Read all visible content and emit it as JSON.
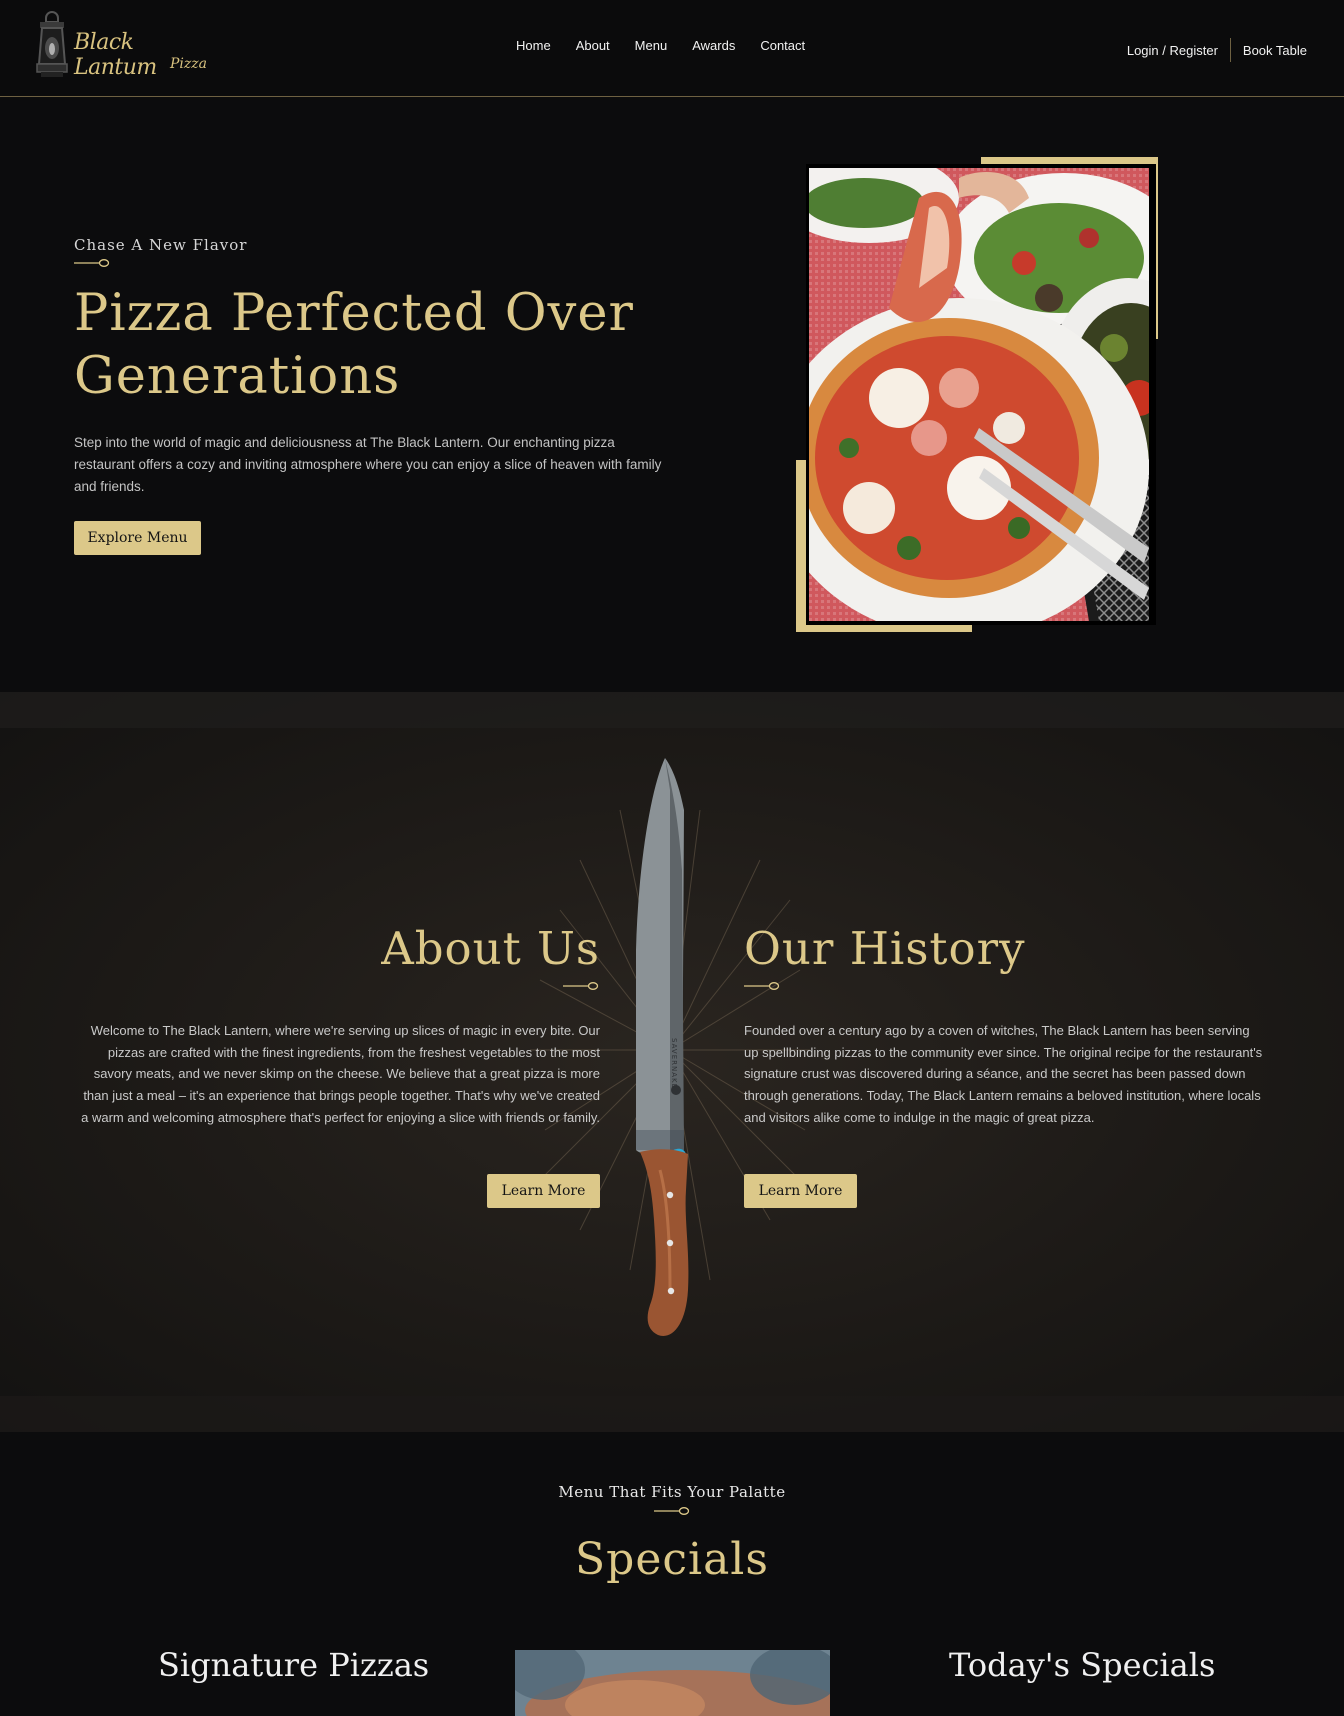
{
  "header": {
    "brand_main": "Black Lantum",
    "brand_sub": "Pizza",
    "nav": [
      "Home",
      "About",
      "Menu",
      "Awards",
      "Contact"
    ],
    "login_label": "Login / Register",
    "book_label": "Book Table"
  },
  "hero": {
    "kicker": "Chase A New Flavor",
    "title": "Pizza Perfected Over Generations",
    "text": "Step into the world of magic and deliciousness at The Black Lantern. Our enchanting pizza restaurant offers a cozy and inviting atmosphere where you can enjoy a slice of heaven with family and friends.",
    "button_label": "Explore Menu"
  },
  "about": {
    "title": "About Us",
    "text": "Welcome to The Black Lantern, where we're serving up slices of magic in every bite. Our pizzas are crafted with the finest ingredients, from the freshest vegetables to the most savory meats, and we never skimp on the cheese. We believe that a great pizza is more than just a meal – it's an experience that brings people together. That's why we've created a warm and welcoming atmosphere that's perfect for enjoying a slice with friends or family.",
    "button_label": "Learn More"
  },
  "history": {
    "title": "Our History",
    "text": "Founded over a century ago by a coven of witches, The Black Lantern has been serving up spellbinding pizzas to the community ever since. The original recipe for the restaurant's signature crust was discovered during a séance, and the secret has been passed down through generations. Today, The Black Lantern remains a beloved institution, where locals and visitors alike come to indulge in the magic of great pizza.",
    "button_label": "Learn More"
  },
  "knife_brand": "SAVERNAKE",
  "specials": {
    "kicker": "Menu That Fits Your Palatte",
    "title": "Specials",
    "col_left": "Signature Pizzas",
    "col_right": "Today's Specials"
  },
  "colors": {
    "accent": "#dcc889",
    "background": "#0c0c0d"
  }
}
